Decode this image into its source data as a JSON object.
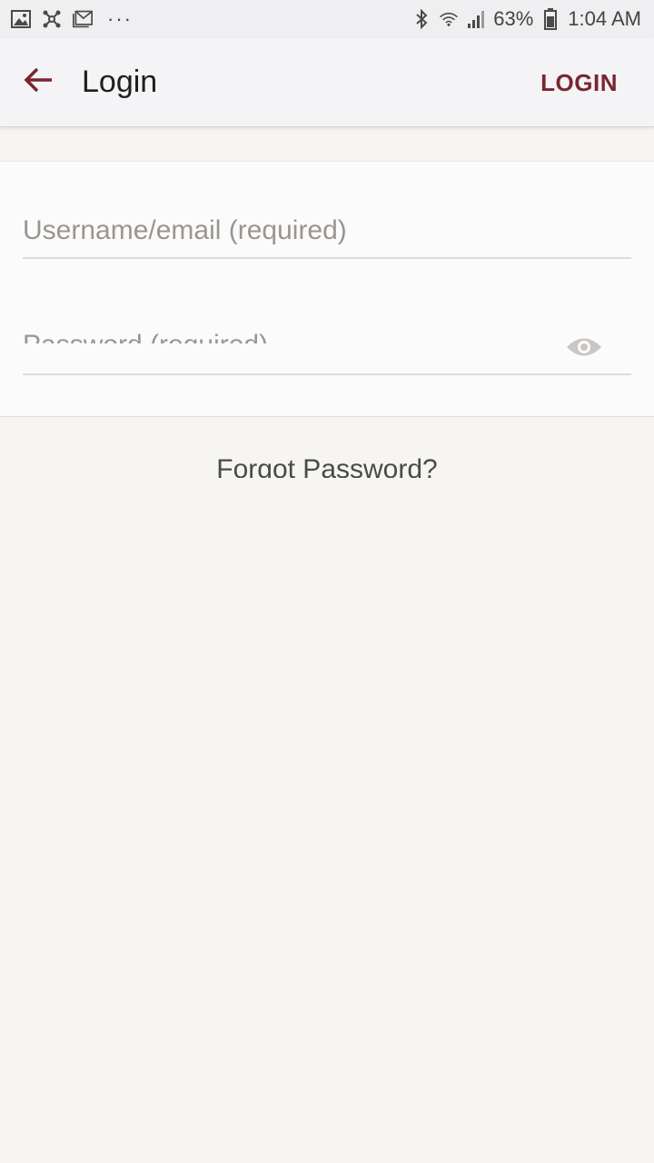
{
  "status_bar": {
    "left_icons": [
      "gallery-icon",
      "hub-icon",
      "gmail-icon"
    ],
    "more": "···",
    "battery_percent": "63%",
    "time": "1:04 AM",
    "right_icons": [
      "bluetooth-icon",
      "wifi-icon",
      "signal-icon",
      "battery-icon"
    ]
  },
  "app_bar": {
    "back_icon": "arrow-left-icon",
    "title": "Login",
    "action_label": "LOGIN",
    "accent_color": "#7a2531"
  },
  "form": {
    "username_placeholder": "Username/email (required)",
    "username_value": "",
    "password_placeholder": "Password (required)",
    "password_value": "",
    "toggle_icon": "eye-icon"
  },
  "forgot_password": "Forgot Password?"
}
